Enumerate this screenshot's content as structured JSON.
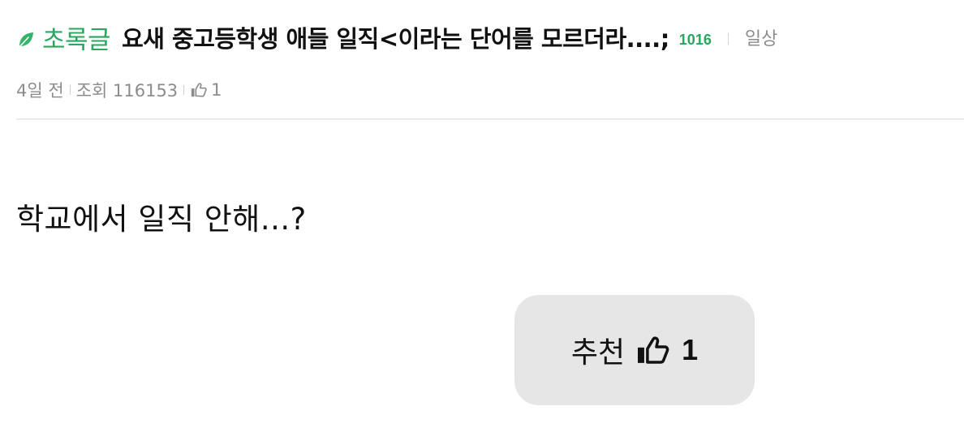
{
  "post": {
    "category": "초록글",
    "title": "요새 중고등학생 애들 일직<이라는 단어를 모르더라....;",
    "comment_count": "1016",
    "board": "일상",
    "time_ago": "4일 전",
    "views": "조회 116153",
    "likes": "1",
    "body": "학교에서 일직 안해...?"
  },
  "recommend": {
    "label": "추천",
    "count": "1"
  },
  "icons": {
    "category": "leaf-icon",
    "like": "thumbs-up-icon"
  },
  "colors": {
    "accent": "#27a85e",
    "muted": "#8c8c8c",
    "button_bg": "#e6e6e6"
  }
}
